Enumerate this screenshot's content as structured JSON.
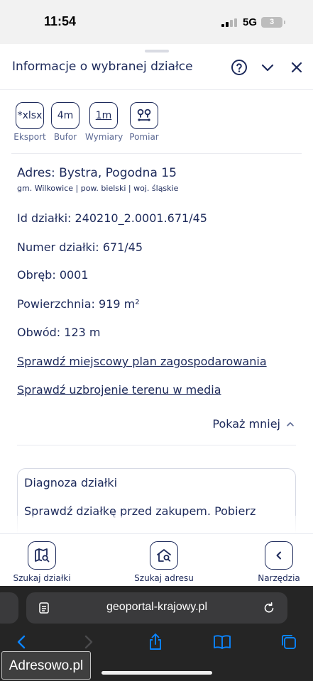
{
  "status_bar": {
    "time": "11:54",
    "network": "5G",
    "battery": "3"
  },
  "panel": {
    "title": "Informacje o wybranej działce",
    "tools": [
      {
        "icon_text": "*xlsx",
        "label": "Eksport"
      },
      {
        "icon_text": "4m",
        "label": "Bufor"
      },
      {
        "icon_text": "1m",
        "label": "Wymiary"
      },
      {
        "icon_text": "",
        "label": "Pomiar"
      }
    ],
    "address": "Adres: Bystra, Pogodna 15",
    "address_sub": "gm. Wilkowice | pow. bielski | woj. śląskie",
    "fields": [
      {
        "label": "Id działki: ",
        "value": "240210_2.0001.671/45"
      },
      {
        "label": "Numer działki: ",
        "value": "671/45"
      },
      {
        "label": "Obręb: ",
        "value": "0001"
      },
      {
        "label": "Powierzchnia: ",
        "value": "919 m²"
      },
      {
        "label": "Obwód: ",
        "value": "123 m"
      }
    ],
    "links": [
      "Sprawdź miejscowy plan zagospodarowania",
      "Sprawdź uzbrojenie terenu w media"
    ],
    "show_less": "Pokaż mniej",
    "diagnosis": {
      "title": "Diagnoza działki",
      "text": "Sprawdź działkę przed zakupem. Pobierz"
    }
  },
  "bottom_nav": [
    {
      "label": "Szukaj działki"
    },
    {
      "label": "Szukaj adresu"
    },
    {
      "label": "Narzędzia"
    }
  ],
  "browser": {
    "url": "geoportal-krajowy.pl"
  },
  "watermark": "Adresowo.pl",
  "colors": {
    "primary": "#1d2a5b",
    "muted": "#5c6993",
    "browser_bg": "#252525",
    "browser_accent": "#0a84ff"
  }
}
